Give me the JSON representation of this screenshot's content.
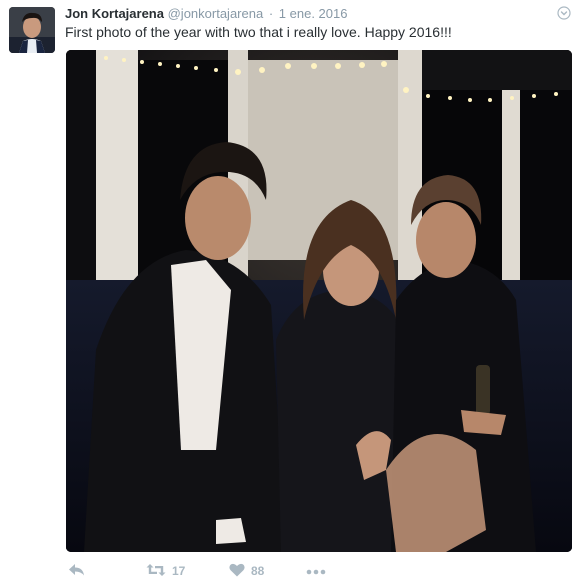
{
  "tweet": {
    "fullname": "Jon Kortajarena",
    "username": "@jonkortajarena",
    "separator": "·",
    "timestamp": "1 ene. 2016",
    "text": "First photo of the year with two that i really love. Happy 2016!!!"
  },
  "actions": {
    "retweet_count": "17",
    "like_count": "88"
  },
  "icons": {
    "reply": "reply-icon",
    "retweet": "retweet-icon",
    "like": "heart-icon",
    "more": "more-dots-icon",
    "caret": "chevron-down-icon"
  },
  "colors": {
    "text": "#292f33",
    "secondary": "#8899a6",
    "action_icon": "#aab8c2"
  }
}
